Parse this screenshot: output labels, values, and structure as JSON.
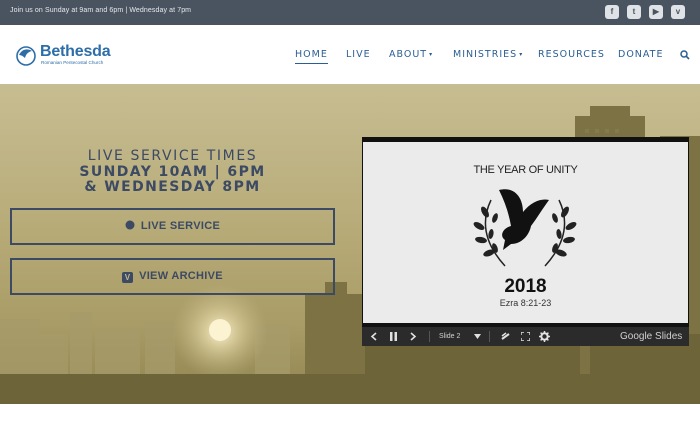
{
  "topbar": {
    "announcement": "Join us on Sunday at 9am and 6pm | Wednesday at 7pm",
    "social": [
      {
        "icon": "facebook-icon",
        "glyph": "f"
      },
      {
        "icon": "twitter-icon",
        "glyph": "t"
      },
      {
        "icon": "youtube-icon",
        "glyph": "▶"
      },
      {
        "icon": "vimeo-icon",
        "glyph": "v"
      }
    ]
  },
  "logo": {
    "name": "Bethesda",
    "subtitle": "Romanian Pentecostal Church"
  },
  "nav": {
    "items": [
      {
        "label": "HOME"
      },
      {
        "label": "LIVE"
      },
      {
        "label": "ABOUT",
        "caret": "▾"
      },
      {
        "label": "MINISTRIES",
        "caret": "▾"
      },
      {
        "label": "RESOURCES"
      },
      {
        "label": "DONATE"
      }
    ]
  },
  "hero": {
    "heading_line1": "LIVE SERVICE TIMES",
    "heading_line2": "SUNDAY 10AM | 6PM",
    "heading_line3": "& WEDNESDAY 8PM",
    "live_button": "LIVE SERVICE",
    "archive_button": "VIEW ARCHIVE",
    "archive_icon_glyph": "V"
  },
  "slides": {
    "title": "THE YEAR OF UNITY",
    "year": "2018",
    "reference": "Ezra 8:21-23",
    "current_slide": "Slide 2",
    "brand": "Google Slides"
  },
  "colors": {
    "topbar": "#4a5461",
    "nav_text": "#2b5f93",
    "hero_text": "#3c4a63"
  }
}
